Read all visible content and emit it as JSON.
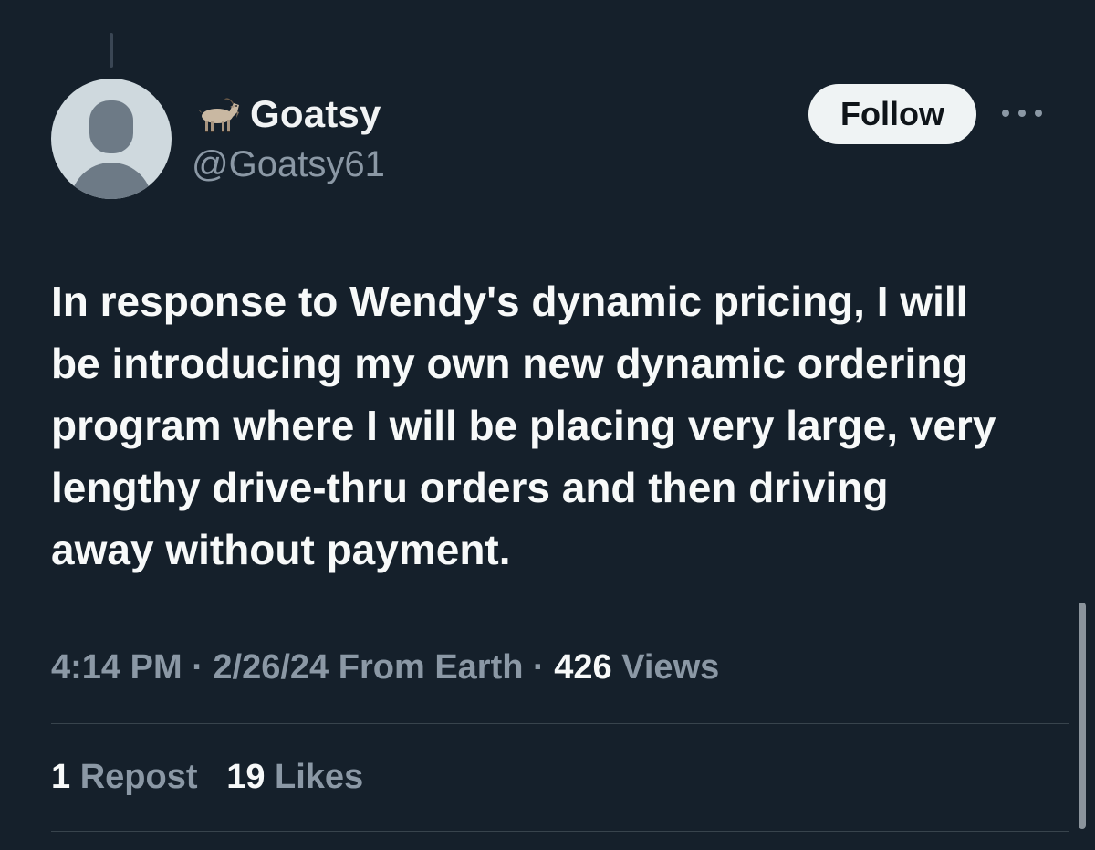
{
  "user": {
    "display_name": "Goatsy",
    "handle": "@Goatsy61",
    "name_icon": "goat-emoji-icon"
  },
  "actions": {
    "follow_label": "Follow",
    "more_icon": "more-horizontal-icon"
  },
  "tweet": {
    "text": "In response to Wendy's dynamic pricing, I will be introducing my own new dynamic ordering program where I will be placing very large, very lengthy drive-thru orders and then driving away without payment.",
    "time": "4:14 PM",
    "separator": "·",
    "date": "2/26/24",
    "source": "From Earth",
    "views_count": "426",
    "views_label": "Views"
  },
  "stats": {
    "reposts_count": "1",
    "reposts_label": "Repost",
    "likes_count": "19",
    "likes_label": "Likes"
  },
  "colors": {
    "background": "#15202b",
    "primary_text": "#f7f9f9",
    "secondary_text": "#8b98a5",
    "follow_bg": "#eff3f4",
    "divider": "#38444d"
  }
}
